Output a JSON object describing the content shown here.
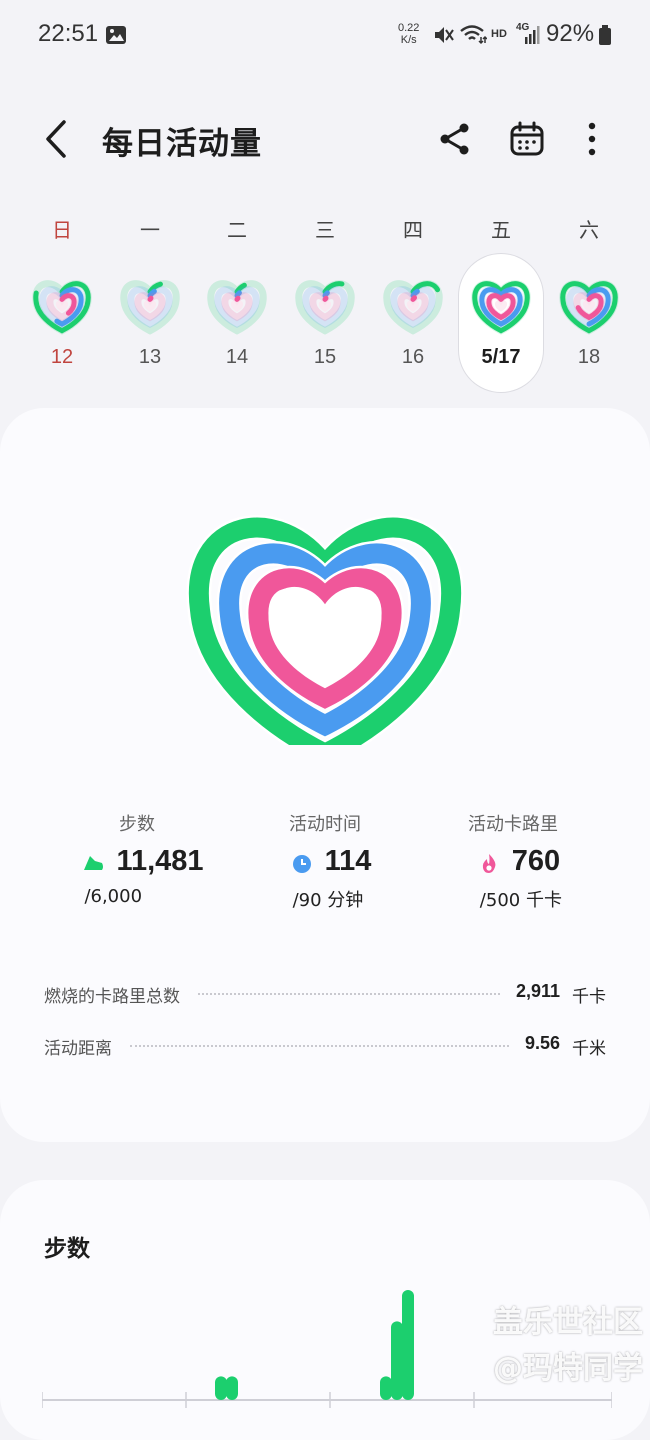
{
  "status_bar": {
    "time": "22:51",
    "net_speed_value": "0.22",
    "net_speed_unit": "K/s",
    "network": "4G",
    "hd": "HD",
    "battery": "92%",
    "icons": [
      "gallery-icon",
      "mute-icon",
      "wifi-icon",
      "hd-icon",
      "signal-icon",
      "battery-icon"
    ]
  },
  "header": {
    "title": "每日活动量",
    "icons": [
      "back-arrow-icon",
      "share-icon",
      "calendar-icon",
      "more-icon"
    ]
  },
  "week": {
    "weekdays": [
      "日",
      "一",
      "二",
      "三",
      "四",
      "五",
      "六"
    ],
    "dates": [
      "12",
      "13",
      "14",
      "15",
      "16",
      "5/17",
      "18"
    ],
    "selected_index": 5,
    "sunday_color": "#c0453f",
    "progress": [
      {
        "steps": 0.8,
        "time": 0.55,
        "calories": 0.4,
        "active": true
      },
      {
        "steps": 0.08,
        "time": 0.05,
        "calories": 0.02,
        "active": false
      },
      {
        "steps": 0.06,
        "time": 0.03,
        "calories": 0.02,
        "active": false
      },
      {
        "steps": 0.12,
        "time": 0.03,
        "calories": 0.02,
        "active": false
      },
      {
        "steps": 0.18,
        "time": 0.05,
        "calories": 0.03,
        "active": false
      },
      {
        "steps": 1.0,
        "time": 1.0,
        "calories": 1.0,
        "active": true
      },
      {
        "steps": 1.0,
        "time": 0.5,
        "calories": 0.7,
        "active": true
      }
    ]
  },
  "summary": {
    "rings": {
      "steps_color": "#1ccf6e",
      "time_color": "#4a9bf0",
      "calories_color": "#f0579a"
    },
    "stats": [
      {
        "label": "步数",
        "value": "11,481",
        "goal": "/6,000",
        "icon": "shoe-icon",
        "color": "#1ccf6e"
      },
      {
        "label": "活动时间",
        "value": "114",
        "goal": "/90 分钟",
        "icon": "clock-icon",
        "color": "#4a9bf0"
      },
      {
        "label": "活动卡路里",
        "value": "760",
        "goal": "/500 千卡",
        "icon": "flame-icon",
        "color": "#f0579a"
      }
    ],
    "rows": [
      {
        "label": "燃烧的卡路里总数",
        "value": "2,911",
        "unit": "千卡"
      },
      {
        "label": "活动距离",
        "value": "9.56",
        "unit": "千米"
      }
    ]
  },
  "steps_card": {
    "title": "步数",
    "bar_color": "#1ccf6e",
    "hourly_steps": [
      0,
      0,
      0,
      0,
      0,
      0,
      0,
      0,
      0,
      0,
      0,
      0,
      0,
      0,
      0,
      0,
      0,
      0,
      0,
      0,
      0,
      0,
      0,
      0,
      0,
      0,
      30,
      0,
      30,
      0,
      0,
      0,
      0,
      0,
      0,
      0,
      0,
      0,
      0,
      0,
      0,
      0,
      0,
      0,
      0,
      0,
      0,
      0,
      0,
      0,
      0,
      0,
      0,
      0,
      0,
      0,
      30,
      0,
      100,
      0,
      140,
      0,
      0,
      0,
      0,
      0,
      0,
      0,
      0,
      0,
      0,
      0,
      0,
      0,
      0,
      0,
      0,
      0,
      0,
      0,
      0,
      0,
      0,
      0,
      0,
      0,
      0,
      0,
      0,
      0,
      0,
      0,
      0,
      0,
      0,
      0
    ]
  },
  "watermark": {
    "line1": "盖乐世社区",
    "line2": "@玛特同学"
  }
}
